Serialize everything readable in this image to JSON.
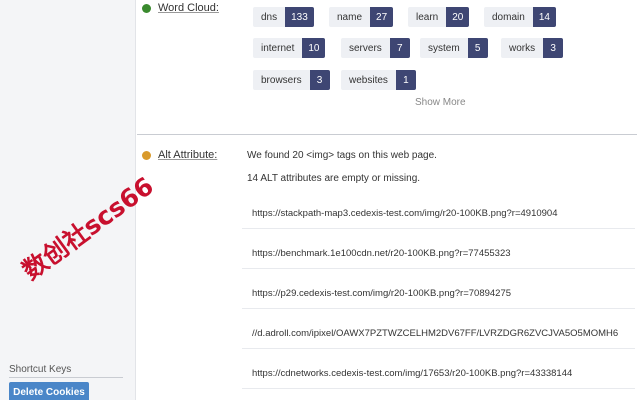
{
  "watermark": "数创社scs66",
  "sidebar": {
    "shortcut_label": "Shortcut Keys",
    "delete_cookies_label": "Delete Cookies"
  },
  "word_cloud": {
    "label": "Word Cloud:",
    "dot_color": "#3a8a2e",
    "tags": [
      {
        "name": "dns",
        "count": "133"
      },
      {
        "name": "name",
        "count": "27"
      },
      {
        "name": "learn",
        "count": "20"
      },
      {
        "name": "domain",
        "count": "14"
      },
      {
        "name": "internet",
        "count": "10"
      },
      {
        "name": "servers",
        "count": "7"
      },
      {
        "name": "system",
        "count": "5"
      },
      {
        "name": "works",
        "count": "3"
      },
      {
        "name": "browsers",
        "count": "3"
      },
      {
        "name": "websites",
        "count": "1"
      }
    ],
    "show_more": "Show More"
  },
  "alt_attribute": {
    "label": "Alt Attribute:",
    "dot_color": "#d99a2b",
    "found_text": "We found 20 <img> tags on this web page.",
    "empty_text": "14 ALT attributes are empty or missing.",
    "urls": [
      "https://stackpath-map3.cedexis-test.com/img/r20-100KB.png?r=4910904",
      "https://benchmark.1e100cdn.net/r20-100KB.png?r=77455323",
      "https://p29.cedexis-test.com/img/r20-100KB.png?r=70894275",
      "//d.adroll.com/ipixel/OAWX7PZTWZCELHM2DV67FF/LVRZDGR6ZVCJVA5O5MOMH6",
      "https://cdnetworks.cedexis-test.com/img/17653/r20-100KB.png?r=43338144"
    ]
  }
}
